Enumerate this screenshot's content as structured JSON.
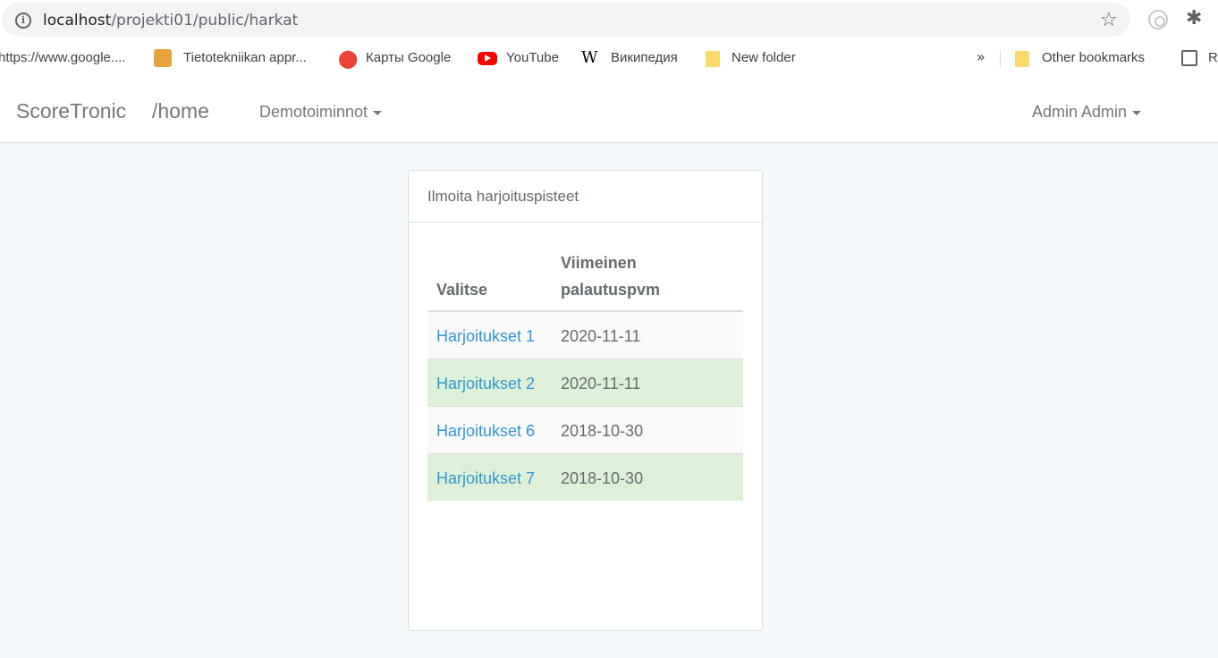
{
  "browser": {
    "url_host": "localhost",
    "url_path": "/projekti01/public/harkat",
    "bookmarks": [
      {
        "label": "https://www.google...."
      },
      {
        "label": "Tietotekniikan appr..."
      },
      {
        "label": "Карты Google"
      },
      {
        "label": "YouTube"
      },
      {
        "label": "Википедия"
      },
      {
        "label": "New folder"
      }
    ],
    "overflow_label": "»",
    "other_bookmarks": "Other bookmarks",
    "reading_list_partial": "R"
  },
  "navbar": {
    "brand": "ScoreTronic",
    "path": "/home",
    "menu": "Demotoiminnot",
    "user": "Admin Admin"
  },
  "panel": {
    "heading": "Ilmoita harjoituspisteet",
    "columns": [
      "Valitse",
      "Viimeinen palautuspvm"
    ],
    "rows": [
      {
        "name": "Harjoitukset 1",
        "date": "2020-11-11",
        "status": "default"
      },
      {
        "name": "Harjoitukset 2",
        "date": "2020-11-11",
        "status": "success"
      },
      {
        "name": "Harjoitukset 6",
        "date": "2018-10-30",
        "status": "default"
      },
      {
        "name": "Harjoitukset 7",
        "date": "2018-10-30",
        "status": "success"
      }
    ]
  },
  "colors": {
    "link": "#3097d1",
    "success_row": "#dff0d8",
    "striped_row": "#f9f9f9",
    "page_bg": "#f5f8fa"
  }
}
